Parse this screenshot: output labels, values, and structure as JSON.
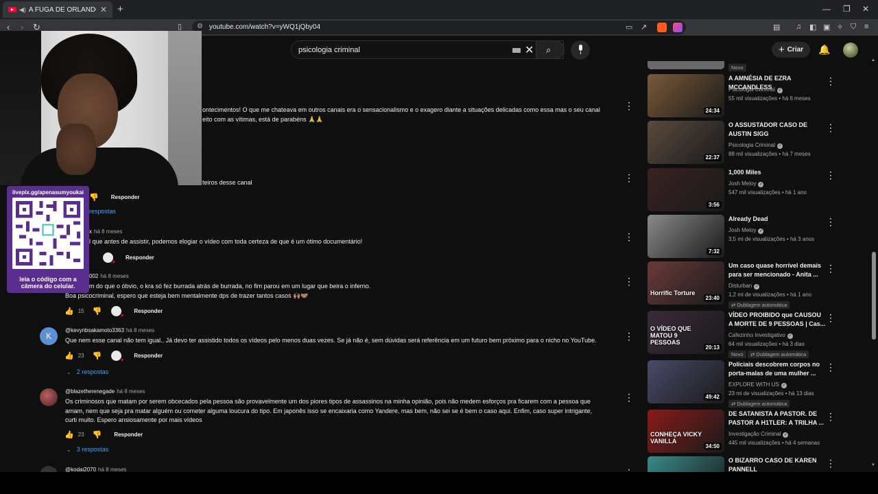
{
  "browser": {
    "tab_title": "A FUGA DE ORLANDO TERCE",
    "tab_close": "✕",
    "new_tab": "+",
    "url": "youtube.com/watch?v=yWQ1jQby04",
    "window_min": "—",
    "window_restore": "❐",
    "window_close": "✕"
  },
  "youtube": {
    "search_query": "psicologia criminal",
    "create_label": "Criar"
  },
  "overlay": {
    "qr_link": "livepix.gg/apenasumyoukai",
    "qr_caption": "leia o código com a câmera do celular."
  },
  "comments": [
    {
      "lines": [
        "ontecimentos! O que me chateava em outros canais era o sensacionalismo e o exagero diante a situações delicadas como essa mas o seu canal",
        "eito com as vítimas, está de parabéns 🙏🙏"
      ]
    },
    {
      "lines": [
        "teiros desse canal"
      ],
      "reply_label": "Responder",
      "replies_label": "respostas"
    },
    {
      "handle_partial": "x",
      "time": "há 8 meses",
      "lines": [
        "l que antes de assistir, podemos elogiar o vídeo com toda certeza de que é um ótimo documentário!"
      ],
      "reply_label": "Responder"
    },
    {
      "handle_partial": "002",
      "time": "há 8 meses",
      "lines": [
        "m do que o óbvio, o kra só fez burrada atrás de burrada, no fim parou em um lugar que beira o inferno.",
        "Boa psicocriminal, espero que esteja bem mentalmente dps de trazer tantos casos 🙌🏽🤝🏽"
      ],
      "likes": "15",
      "reply_label": "Responder"
    },
    {
      "avatar_letter": "K",
      "handle": "@kevynbsakamoto3363",
      "time": "há 8 meses",
      "lines": [
        "Que nem esse canal não tem igual.. Já devo ter assistido todos os vídeos pelo menos duas vezes. Se já não é, sem dúvidas será referência em um futuro bem próximo para o nicho no YouTube."
      ],
      "likes": "23",
      "reply_label": "Responder",
      "replies_label": "2 respostas"
    },
    {
      "handle": "@blazetherenegade",
      "time": "há 8 meses",
      "lines": [
        "Os criminosos que matam por serem obcecados pela pessoa são provavelmente um dos piores tipos de assassinos na minha opinião, pois não medem esforços pra ficarem com a pessoa que",
        "amam, nem que seja pra matar alguém ou cometer alguma loucura do tipo. Em japonês isso se encaixaria como Yandere, mas bem, não sei se é bem o caso aqui. Enfim, caso super intrigante,",
        "curti muito. Espero ansiosamente por mais vídeos"
      ],
      "likes": "23",
      "reply_label": "Responder",
      "replies_label": "3 respostas"
    },
    {
      "handle": "@kodai2070",
      "time": "há 8 meses"
    }
  ],
  "sidebar": {
    "top_badge": "Novo",
    "videos": [
      {
        "title": "A AMNÉSIA DE EZRA MCCANDLESS",
        "channel": "Psicologia Criminal",
        "views": "55 mil visualizações • há 6 meses",
        "duration": "24:34",
        "thumb_color": "#7a5a3a"
      },
      {
        "title": "O ASSUSTADOR CASO DE AUSTIN SIGG",
        "channel": "Psicologia Criminal",
        "views": "88 mil visualizações • há 7 meses",
        "duration": "22:37",
        "thumb_color": "#5a4a3e"
      },
      {
        "title": "1,000 Miles",
        "channel": "Josh Meloy",
        "views": "547 mil visualizações • há 1 ano",
        "duration": "3:56",
        "thumb_color": "#3a2222"
      },
      {
        "title": "Already Dead",
        "channel": "Josh Meloy",
        "views": "3,5 mi de visualizações • há 3 anos",
        "duration": "7:32",
        "thumb_color": "#8a8a8a"
      },
      {
        "title": "Um caso quase horrível demais para ser mencionado - Anita ...",
        "channel": "Disturban",
        "views": "1,2 mi de visualizações • há 1 ano",
        "duration": "23:40",
        "thumb_color": "#6a3a3a",
        "thumb_text": "Horrific Torture",
        "badge": "Dublagem automática"
      },
      {
        "title": "VÍDEO PROIBIDO que CAUSOU A MORTE DE 9 PESSOAS | Cas...",
        "channel": "Cafezinho Investigativo",
        "views": "64 mil visualizações • há 3 dias",
        "duration": "20:13",
        "thumb_color": "#3a2a3a",
        "thumb_text": "O VÍDEO QUE MATOU 9 PESSOAS",
        "badge_new": "Novo",
        "badge": "Dublagem automática"
      },
      {
        "title": "Policiais descobrem corpos no porta-malas de uma mulher ...",
        "channel": "EXPLORE WITH US",
        "views": "23 mi de visualizações • há 13 dias",
        "duration": "49:42",
        "thumb_color": "#4a4a6a",
        "badge": "Dublagem automática"
      },
      {
        "title": "DE SATANISTA A PASTOR. DE PASTOR A H1TLER: A TRILHA ...",
        "channel": "Investigação Criminal",
        "views": "445 mil visualizações • há 4 semanas",
        "duration": "34:50",
        "thumb_color": "#8a1a1a",
        "thumb_text": "CONHEÇA VICKY VANILLA"
      },
      {
        "title": "O BIZARRO CASO DE KAREN PANNELL",
        "channel": "",
        "views": "",
        "duration": "",
        "thumb_color": "#3a8a8a"
      }
    ]
  }
}
